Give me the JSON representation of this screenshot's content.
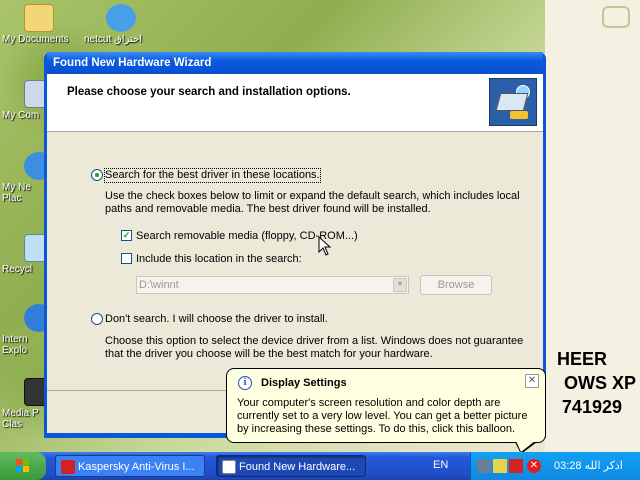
{
  "desktop": {
    "icons": [
      {
        "label": "My Documents"
      },
      {
        "label": "netcut اختراق"
      },
      {
        "label": "My Com"
      },
      {
        "label": "My Ne\nPlac"
      },
      {
        "label": "Recycl"
      },
      {
        "label": "Intern\nExplo"
      },
      {
        "label": "Media P\nClas"
      }
    ],
    "overlay_lines": [
      "HEER",
      "OWS XP",
      "741929"
    ]
  },
  "wizard": {
    "title": "Found New Hardware Wizard",
    "header": "Please choose your search and installation options.",
    "option_search": "Search for the best driver in these locations.",
    "option_search_desc": "Use the check boxes below to limit or expand the default search, which includes local paths and removable media. The best driver found will be installed.",
    "check_removable": "Search removable media (floppy, CD-ROM...)",
    "check_location": "Include this location in the search:",
    "location_value": "D:\\winnt",
    "browse_label": "Browse",
    "option_dont": "Don't search. I will choose the driver to install.",
    "option_dont_desc": "Choose this option to select the device driver from a list.  Windows does not guarantee that the driver you choose will be the best match for your hardware.",
    "search_selected": true,
    "removable_checked": true,
    "location_checked": false
  },
  "balloon": {
    "title": "Display Settings",
    "text": "Your computer's screen resolution and color depth are currently set to a very low level. You can get a better picture by increasing these settings. To do this, click this balloon.",
    "close_glyph": "✕",
    "info_glyph": "i"
  },
  "taskbar": {
    "tasks": [
      {
        "label": "Kaspersky Anti-Virus I...",
        "icon_color": "#d22222"
      },
      {
        "label": "Found New Hardware...",
        "icon_color": "#ffffff"
      }
    ],
    "language": "EN",
    "clock": "03:28 اذكر الله"
  },
  "colors": {
    "title_blue": "#0a58d8",
    "dialog_bg": "#ece9d8",
    "balloon_bg": "#ffffe1",
    "taskbar_blue": "#2458d8",
    "start_green": "#3a9a3a"
  },
  "icons": {
    "start": "windows-flag-icon",
    "hardware": "hardware-wizard-icon",
    "info": "info-icon",
    "close": "close-icon",
    "dropdown": "chevron-down-icon"
  }
}
